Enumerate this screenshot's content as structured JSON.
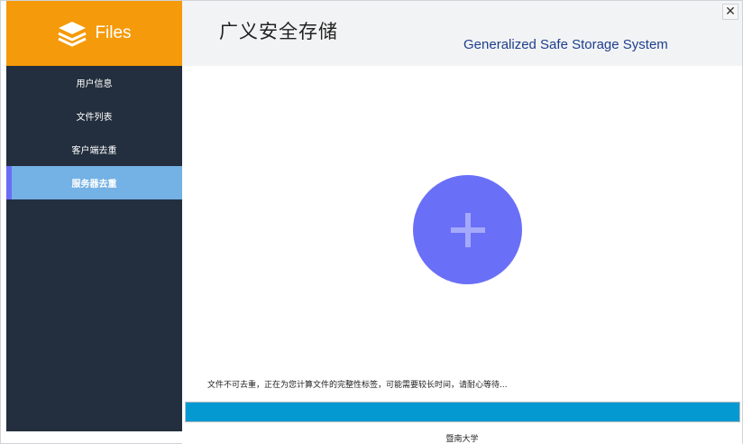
{
  "window": {
    "close_label": "✕"
  },
  "sidebar": {
    "logo_text": "Files",
    "items": [
      {
        "label": "用户信息"
      },
      {
        "label": "文件列表"
      },
      {
        "label": "客户端去重"
      },
      {
        "label": "服务器去重"
      }
    ],
    "active_index": 3,
    "colors": {
      "logo_bg": "#f59a0a",
      "sidebar_bg": "#232f3e",
      "active_bg": "#74b1e4",
      "active_marker": "#6b6cf6"
    }
  },
  "header": {
    "title_cn": "广义安全存储",
    "title_en": "Generalized Safe Storage System"
  },
  "main": {
    "upload_icon": "plus-icon",
    "upload_color": "#6a6ff7",
    "status_text": "文件不可去重，正在为您计算文件的完整性标签，可能需要较长时间，请耐心等待...",
    "progress_percent": 100,
    "progress_color": "#0599d2"
  },
  "footer": {
    "text": "暨南大学"
  }
}
